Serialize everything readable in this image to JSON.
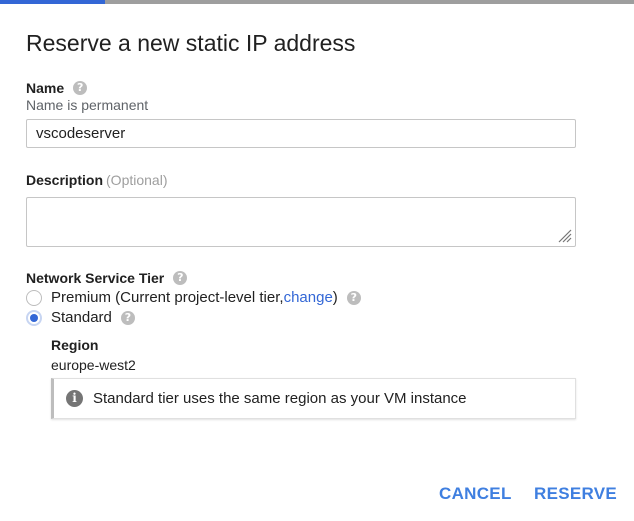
{
  "dialog": {
    "title": "Reserve a new static IP address",
    "progress_fraction": 0.165
  },
  "name_field": {
    "label": "Name",
    "help_icon": "help-icon",
    "note": "Name is permanent",
    "value": "vscodeserver"
  },
  "description_field": {
    "label": "Description",
    "optional": "(Optional)",
    "value": ""
  },
  "tier": {
    "label": "Network Service Tier",
    "premium": {
      "label": "Premium (Current project-level tier, ",
      "link": "change",
      "suffix": ")",
      "selected": false
    },
    "standard": {
      "label": "Standard",
      "selected": true
    }
  },
  "region": {
    "label": "Region",
    "value": "europe-west2"
  },
  "info": {
    "icon": "info-icon",
    "text": "Standard tier uses the same region as your VM instance"
  },
  "actions": {
    "cancel": "CANCEL",
    "reserve": "RESERVE"
  },
  "colors": {
    "accent": "#3367d6",
    "button_text": "#3f7fe0"
  }
}
